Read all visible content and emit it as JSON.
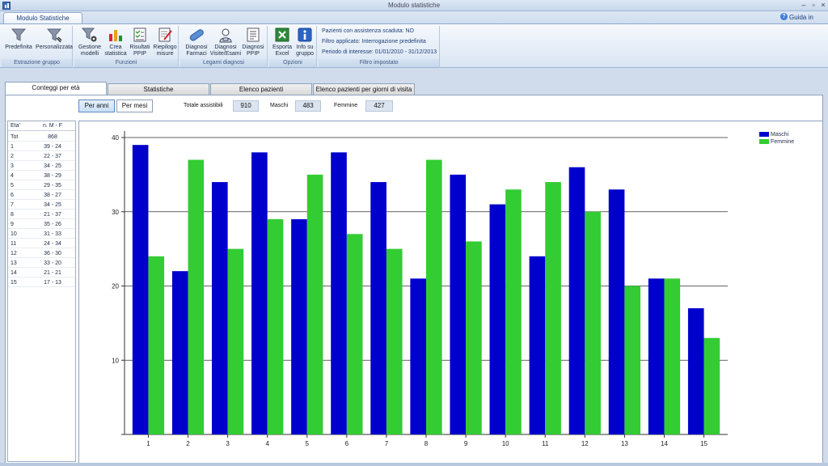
{
  "window": {
    "title": "Modulo statistiche"
  },
  "ribbon": {
    "tab_label": "Modulo Statistiche",
    "help_label": "Guida in linea",
    "groups": {
      "estrazione": {
        "label": "Estrazione gruppo",
        "predefinita": "Predefinita",
        "personalizzata": "Personalizzata"
      },
      "funzioni": {
        "label": "Funzioni",
        "gestione": "Gestione\nmodelli",
        "crea": "Crea\nstatistica",
        "risultati": "Risultati\nPPIP",
        "riepilogo": "Riepilogo\nmisure"
      },
      "legami": {
        "label": "Legami diagnosi",
        "farmaci": "Diagnosi\nFarmaci",
        "visite": "Diagnosi\nVisite/Esami",
        "ppip": "Diagnosi\nPPIP"
      },
      "opzioni": {
        "label": "Opzioni",
        "esporta": "Esporta\nExcel",
        "info": "Info su\ngruppo"
      },
      "filtro": {
        "label": "Filtro impostato",
        "line1": "Pazienti con assistenza scaduta: NO",
        "line2": "Filtro applicato: Interrogazione predefinita",
        "line3": "Periodo di interesse: 01/01/2010 - 31/12/2013"
      }
    }
  },
  "tabs": [
    {
      "label": "Conteggi per età"
    },
    {
      "label": "Statistiche"
    },
    {
      "label": "Elenco pazienti"
    },
    {
      "label": "Elenco pazienti per giorni di visita"
    }
  ],
  "controls": {
    "per_anni": "Per anni",
    "per_mesi": "Per mesi",
    "totale_label": "Totale assistibili",
    "totale_value": "910",
    "maschi_label": "Maschi",
    "maschi_value": "483",
    "femmine_label": "Femmine",
    "femmine_value": "427"
  },
  "age_table": {
    "headers": [
      "Eta'",
      "n. M - F"
    ],
    "rows": [
      [
        "Tot",
        "868"
      ],
      [
        "1",
        "39 - 24"
      ],
      [
        "2",
        "22 - 37"
      ],
      [
        "3",
        "34 - 25"
      ],
      [
        "4",
        "38 - 29"
      ],
      [
        "5",
        "29 - 35"
      ],
      [
        "6",
        "38 - 27"
      ],
      [
        "7",
        "34 - 25"
      ],
      [
        "8",
        "21 - 37"
      ],
      [
        "9",
        "35 - 26"
      ],
      [
        "10",
        "31 - 33"
      ],
      [
        "11",
        "24 - 34"
      ],
      [
        "12",
        "36 - 30"
      ],
      [
        "13",
        "33 - 20"
      ],
      [
        "14",
        "21 - 21"
      ],
      [
        "15",
        "17 - 13"
      ]
    ]
  },
  "chart_data": {
    "type": "bar",
    "categories": [
      "1",
      "2",
      "3",
      "4",
      "5",
      "6",
      "7",
      "8",
      "9",
      "10",
      "11",
      "12",
      "13",
      "14",
      "15"
    ],
    "series": [
      {
        "name": "Maschi",
        "color": "#0000cc",
        "values": [
          39,
          22,
          34,
          38,
          29,
          38,
          34,
          21,
          35,
          31,
          24,
          36,
          33,
          21,
          17
        ]
      },
      {
        "name": "Femmine",
        "color": "#33cc33",
        "values": [
          24,
          37,
          25,
          29,
          35,
          27,
          25,
          37,
          26,
          33,
          34,
          30,
          20,
          21,
          13
        ]
      }
    ],
    "yticks": [
      10,
      20,
      30,
      40
    ],
    "ylim": [
      0,
      40
    ],
    "grid": true,
    "legend": "top-right",
    "title": "",
    "xlabel": "",
    "ylabel": ""
  }
}
